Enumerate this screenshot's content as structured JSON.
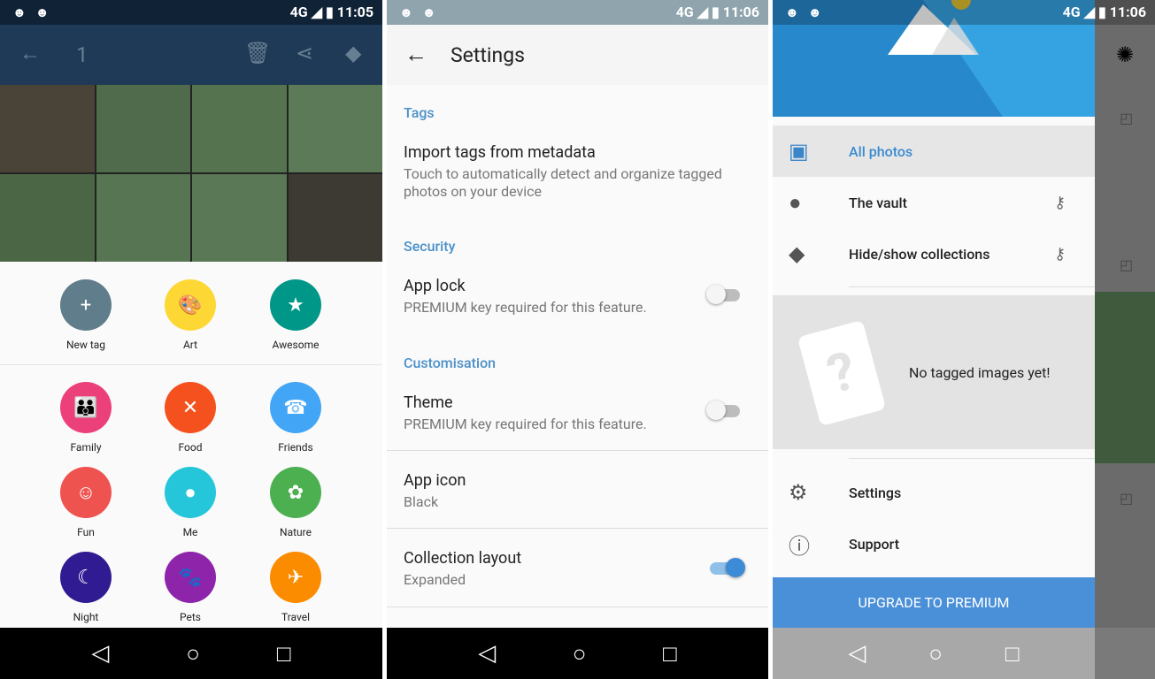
{
  "status": {
    "left": {
      "time": "11:05",
      "net": "4G"
    },
    "mid": {
      "time": "11:06",
      "net": "4G"
    },
    "right": {
      "time": "11:06",
      "net": "4G"
    }
  },
  "gallery": {
    "selected_count": "1",
    "icons": [
      "back-arrow-icon",
      "trash-icon",
      "share-icon",
      "tag-icon"
    ],
    "tags": [
      {
        "label": "New tag",
        "color": "#607d8b",
        "icon": "+"
      },
      {
        "label": "Art",
        "color": "#fdd835",
        "icon": "🎨"
      },
      {
        "label": "Awesome",
        "color": "#009688",
        "icon": "★"
      },
      {
        "label": "Family",
        "color": "#ec407a",
        "icon": "👪"
      },
      {
        "label": "Food",
        "color": "#f4511e",
        "icon": "✕"
      },
      {
        "label": "Friends",
        "color": "#42a5f5",
        "icon": "☎"
      },
      {
        "label": "Fun",
        "color": "#ef5350",
        "icon": "☺"
      },
      {
        "label": "Me",
        "color": "#26c6da",
        "icon": "●"
      },
      {
        "label": "Nature",
        "color": "#4caf50",
        "icon": "✿"
      },
      {
        "label": "Night",
        "color": "#311b92",
        "icon": "☾"
      },
      {
        "label": "Pets",
        "color": "#8e24aa",
        "icon": "🐾"
      },
      {
        "label": "Travel",
        "color": "#fb8c00",
        "icon": "✈"
      }
    ]
  },
  "settings": {
    "title": "Settings",
    "sections": {
      "tags": "Tags",
      "security": "Security",
      "custom": "Customisation"
    },
    "items": {
      "import_title": "Import tags from metadata",
      "import_sub": "Touch to automatically detect and organize tagged photos on your device",
      "applock_title": "App lock",
      "applock_sub": "PREMIUM key required for this feature.",
      "theme_title": "Theme",
      "theme_sub": "PREMIUM key required for this feature.",
      "icon_title": "App icon",
      "icon_sub": "Black",
      "layout_title": "Collection layout",
      "layout_sub": "Expanded"
    },
    "toggles": {
      "app_lock": false,
      "theme": false,
      "collection_layout": true
    }
  },
  "drawer": {
    "all_photos": "All photos",
    "vault": "The vault",
    "hide": "Hide/show collections",
    "empty": "No tagged images yet!",
    "settings": "Settings",
    "support": "Support",
    "upgrade": "UPGRADE TO PREMIUM",
    "accent": "#4a90d9"
  }
}
